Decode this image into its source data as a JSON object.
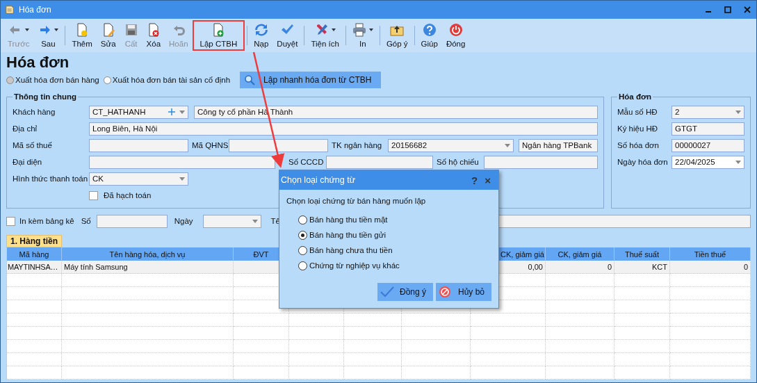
{
  "window": {
    "title": "Hóa đơn"
  },
  "toolbar": {
    "groups": [
      [
        {
          "label": "Trước",
          "disabled": true,
          "dropdown": true,
          "highlighted": false
        },
        {
          "label": "Sau",
          "disabled": false,
          "dropdown": true,
          "highlighted": false
        }
      ],
      [
        {
          "label": "Thêm",
          "disabled": false,
          "dropdown": false,
          "highlighted": false
        },
        {
          "label": "Sửa",
          "disabled": false,
          "dropdown": false,
          "highlighted": false
        },
        {
          "label": "Cất",
          "disabled": true,
          "dropdown": false,
          "highlighted": false
        },
        {
          "label": "Xóa",
          "disabled": false,
          "dropdown": false,
          "highlighted": false
        },
        {
          "label": "Hoãn",
          "disabled": true,
          "dropdown": false,
          "highlighted": false
        },
        {
          "label": "Lập CTBH",
          "disabled": false,
          "dropdown": false,
          "highlighted": true
        }
      ],
      [
        {
          "label": "Nạp",
          "disabled": false,
          "dropdown": false,
          "highlighted": false
        },
        {
          "label": "Duyệt",
          "disabled": false,
          "dropdown": false,
          "highlighted": false
        }
      ],
      [
        {
          "label": "Tiện ích",
          "disabled": false,
          "dropdown": true,
          "highlighted": false
        }
      ],
      [
        {
          "label": "In",
          "disabled": false,
          "dropdown": true,
          "highlighted": false
        }
      ],
      [
        {
          "label": "Góp ý",
          "disabled": false,
          "dropdown": false,
          "highlighted": false
        }
      ],
      [
        {
          "label": "Giúp",
          "disabled": false,
          "dropdown": false,
          "highlighted": false
        },
        {
          "label": "Đóng",
          "disabled": false,
          "dropdown": false,
          "highlighted": false
        }
      ]
    ]
  },
  "heading": "Hóa đơn",
  "invoice_types": [
    {
      "label": "Xuất hóa đơn bán hàng",
      "selected": true
    },
    {
      "label": "Xuất hóa đơn bán tài sản cố định",
      "selected": false
    }
  ],
  "quick_button": "Lập nhanh hóa đơn từ CTBH",
  "general": {
    "title": "Thông tin chung",
    "customer": {
      "label": "Khách hàng",
      "code": "CT_HATHANH",
      "name": "Công ty cổ phần Hà Thành"
    },
    "address": {
      "label": "Địa chỉ",
      "value": "Long Biên, Hà Nội"
    },
    "tax_code": {
      "label": "Mã số thuế"
    },
    "qhns": {
      "label": "Mã QHNS"
    },
    "bank_account": {
      "label": "TK ngân hàng",
      "value": "20156682",
      "bank": "Ngân hàng TPBank"
    },
    "representative": {
      "label": "Đại diện"
    },
    "id_card": {
      "label": "Số CCCD"
    },
    "passport": {
      "label": "Số hộ chiếu"
    },
    "payment_method": {
      "label": "Hình thức thanh toán",
      "value": "CK"
    },
    "posted": {
      "label": "Đã hạch toán",
      "checked": false
    }
  },
  "invoice": {
    "title": "Hóa đơn",
    "fields": [
      {
        "label": "Mẫu số HĐ",
        "value": "2",
        "kind": "dropdown"
      },
      {
        "label": "Ký hiệu HĐ",
        "value": "GTGT",
        "kind": "text"
      },
      {
        "label": "Số hóa đơn",
        "value": "00000027",
        "kind": "text"
      },
      {
        "label": "Ngày hóa đơn",
        "value": "22/04/2025",
        "kind": "date"
      }
    ]
  },
  "attachment": {
    "label": "In kèm bảng kê",
    "checked": false,
    "number_label": "Số",
    "date_label": "Ngày",
    "name_label": "Tê"
  },
  "tabs": [
    {
      "label": "1. Hàng tiền",
      "selected": true
    }
  ],
  "table": {
    "columns": [
      {
        "label": "Mã hàng"
      },
      {
        "label": "Tên hàng hóa, dịch vụ"
      },
      {
        "label": "ĐVT"
      },
      {},
      {},
      {},
      {
        "label": "CK, giảm giá"
      },
      {
        "label": "CK, giảm giá"
      },
      {
        "label": "Thuế suất"
      },
      {
        "label": "Tiền thuế"
      }
    ],
    "rows": [
      {
        "cells": [
          "MAYTINHSA…",
          "Máy tính Samsung",
          null,
          null,
          null,
          null,
          "0,00",
          "0",
          "KCT",
          "0"
        ]
      }
    ]
  },
  "dialog": {
    "title": "Chọn loại chứng từ",
    "help": "?",
    "close": "×",
    "prompt": "Chọn loại chứng từ bán hàng muốn lập",
    "options": [
      {
        "label": "Bán hàng thu tiền mặt",
        "selected": false
      },
      {
        "label": "Bán hàng thu tiền gửi",
        "selected": true
      },
      {
        "label": "Bán hàng chưa thu tiền",
        "selected": false
      },
      {
        "label": "Chứng từ nghiệp vụ khác",
        "selected": false
      }
    ],
    "buttons": [
      {
        "label": "Đồng ý",
        "kind": "ok"
      },
      {
        "label": "Hủy bỏ",
        "kind": "cancel"
      }
    ]
  }
}
